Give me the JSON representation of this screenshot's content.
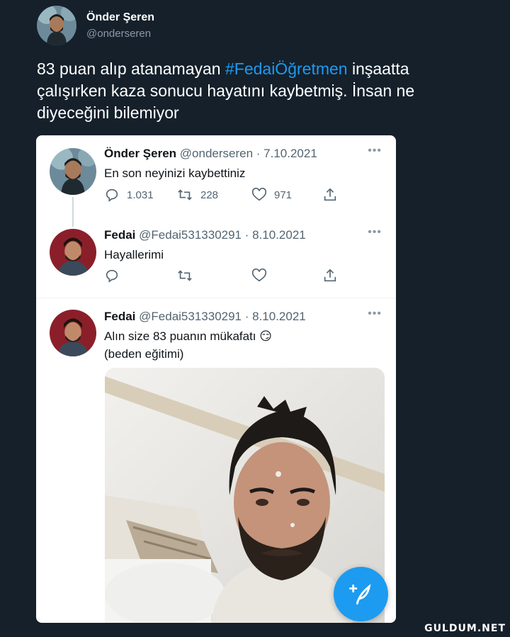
{
  "outer": {
    "name": "Önder Şeren",
    "handle": "@onderseren",
    "text_before": "83 puan alıp atanamayan ",
    "hashtag": "#FedaiÖğretmen",
    "text_after": " inşaatta çalışırken kaza sonucu hayatını kaybetmiş. İnsan ne diyeceğini bilemiyor"
  },
  "tweets": [
    {
      "name": "Önder Şeren",
      "meta": "@onderseren · 7.10.2021",
      "text": "En son neyinizi kaybettiniz",
      "replies": "1.031",
      "retweets": "228",
      "likes": "971"
    },
    {
      "name": "Fedai",
      "meta": "@Fedai531330291 · 8.10.2021",
      "text": "Hayallerimi",
      "replies": "",
      "retweets": "",
      "likes": ""
    },
    {
      "name": "Fedai",
      "meta": "@Fedai531330291 · 8.10.2021",
      "text_line1": "Alın size 83 puanın mükafatı 😏",
      "text_line2": "(beden eğitimi)"
    }
  ],
  "more_label": "•••",
  "watermark": "GULDUM.NET",
  "icons": [
    "reply-icon",
    "retweet-icon",
    "like-icon",
    "share-icon",
    "compose-icon"
  ],
  "colors": {
    "background": "#15202b",
    "accent": "#1d9bf0",
    "muted": "#536471"
  }
}
